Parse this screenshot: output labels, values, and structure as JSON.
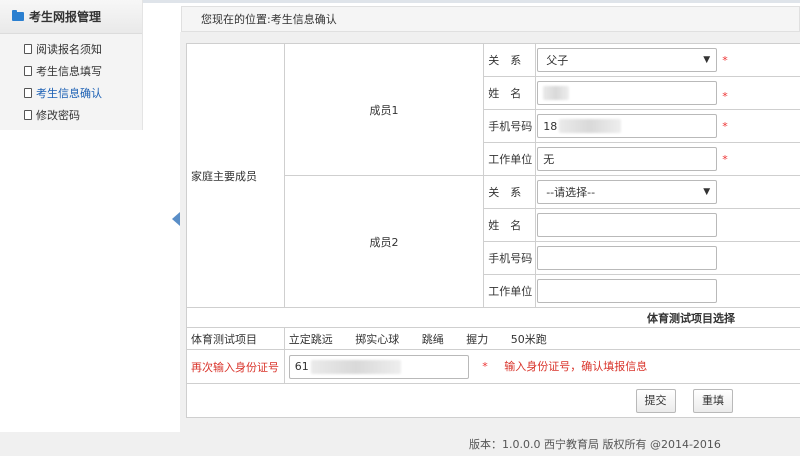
{
  "sidebar": {
    "title": "考生网报管理",
    "items": [
      {
        "label": "阅读报名须知",
        "active": false
      },
      {
        "label": "考生信息填写",
        "active": false
      },
      {
        "label": "考生信息确认",
        "active": true
      },
      {
        "label": "修改密码",
        "active": false
      }
    ]
  },
  "breadcrumb": {
    "prefix": "您现在的位置:",
    "current": "考生信息确认"
  },
  "family": {
    "section_label": "家庭主要成员",
    "labels": {
      "relation": "关　系",
      "name": "姓　名",
      "phone": "手机号码",
      "work": "工作单位"
    },
    "members": [
      {
        "title": "成员1",
        "relation": "父子",
        "name": "",
        "phone": "18",
        "work": "无",
        "required": true
      },
      {
        "title": "成员2",
        "relation": "--请选择--",
        "name": "",
        "phone": "",
        "work": "",
        "required": false
      }
    ]
  },
  "sports": {
    "title": "体育测试项目选择",
    "label": "体育测试项目",
    "items": [
      "立定跳远",
      "掷实心球",
      "跳绳",
      "握力",
      "50米跑"
    ]
  },
  "idno": {
    "label": "再次输入身份证号",
    "value": "61",
    "required_mark": "*",
    "note": "输入身份证号，确认填报信息"
  },
  "buttons": {
    "submit": "提交",
    "reset": "重填"
  },
  "required_mark": "*",
  "footer": "版本：1.0.0.0 西宁教育局 版权所有 @2014-2016",
  "colors": {
    "accent_blue": "#1a5fb4",
    "required_red": "#e33333"
  }
}
